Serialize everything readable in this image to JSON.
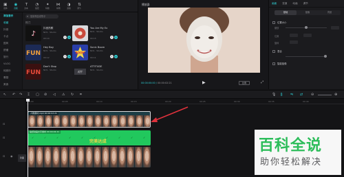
{
  "toolbar": {
    "items": [
      {
        "label": "媒体",
        "icon": "media-icon"
      },
      {
        "label": "音频",
        "icon": "audio-icon"
      },
      {
        "label": "文本",
        "icon": "text-icon"
      },
      {
        "label": "贴纸",
        "icon": "sticker-icon"
      },
      {
        "label": "特效",
        "icon": "effects-icon"
      },
      {
        "label": "转场",
        "icon": "transition-icon"
      },
      {
        "label": "滤镜",
        "icon": "filter-icon"
      },
      {
        "label": "调节",
        "icon": "adjust-icon"
      }
    ],
    "active_index": 1
  },
  "media": {
    "categories": [
      "添加音乐",
      "收藏",
      "抖音",
      "卡点",
      "国风",
      "舒缓",
      "旅行",
      "VLOG",
      "纯音乐",
      "悬疑",
      "美食"
    ],
    "search_placeholder": "搜索歌曲或歌手",
    "section_title": "热门",
    "cards": [
      {
        "title": "抖音热歌",
        "artist": "NCS · Studio",
        "duration": "00:10",
        "thumb": "tiktok"
      },
      {
        "title": "You Are My Ex",
        "artist": "NCS · Studio",
        "duration": "00:15",
        "thumb": "vinyl"
      },
      {
        "title": "Hey Boy",
        "artist": "NCS · Studio",
        "duration": "00:12",
        "thumb": "fun-blue"
      },
      {
        "title": "Sonic Boom",
        "artist": "NCS · Studio",
        "duration": "00:11",
        "thumb": "boom"
      },
      {
        "title": "Don't Stop",
        "artist": "NCS · Studio",
        "duration": "00:20",
        "thumb": "fun-red"
      },
      {
        "title": "ATTITUDE",
        "artist": "NCS · Studio",
        "duration": "00:18",
        "thumb": "attitude"
      }
    ]
  },
  "player": {
    "title": "播放器",
    "current_time": "00:00:00:00",
    "total_time": "00:00:02:21",
    "ratio_label": "比例"
  },
  "inspector": {
    "tabs": [
      "画面",
      "变速",
      "动画",
      "调节"
    ],
    "active_tab": 0,
    "subtabs": [
      "基础",
      "抠像",
      "背景"
    ],
    "active_subtab": 0,
    "rows": [
      "位置大小",
      "混合",
      "智能抠像"
    ],
    "sublabels": [
      "缩放",
      "位置",
      "旋转"
    ]
  },
  "timeline": {
    "ruler_ticks": [
      "00:00",
      "00:05",
      "00:10",
      "00:15",
      "00:20",
      "00:25",
      "00:30",
      "00:35",
      "00:40"
    ],
    "clip1_label": "人物素材.mp4  00:00:02:21",
    "clip2_label": "贴纸动画文字素材 00:00:02:21",
    "sticker_text": "完美达成",
    "cover_label": "封面"
  },
  "watermark": {
    "main": "百科全说",
    "sub": "助你轻松解决"
  },
  "colors": {
    "accent": "#2fd3d8",
    "sticker_track": "#21c85d",
    "watermark_green": "#2cbd5a",
    "arrow": "#e0323c"
  }
}
